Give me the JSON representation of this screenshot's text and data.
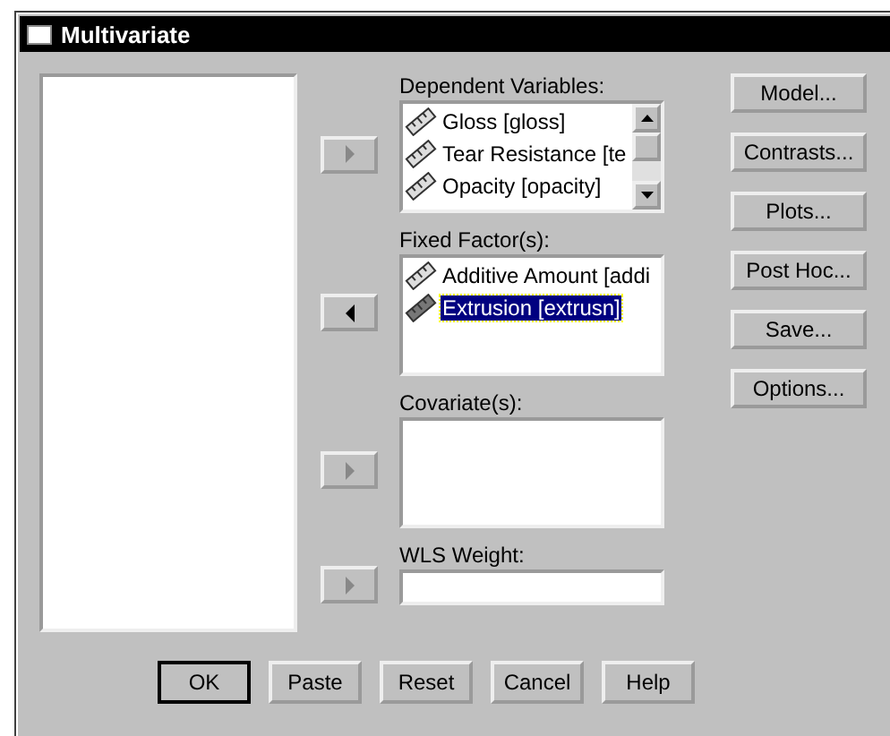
{
  "window": {
    "title": "Multivariate"
  },
  "sections": [
    {
      "label": "Dependent Variables:",
      "kind": "list",
      "arrow": {
        "kind": "right",
        "disabled": true
      },
      "scrollbar": true,
      "items": [
        {
          "text": "Gloss [gloss]",
          "selected": false
        },
        {
          "text": "Tear Resistance [te",
          "selected": false
        },
        {
          "text": "Opacity [opacity]",
          "selected": false
        }
      ]
    },
    {
      "label": "Fixed Factor(s):",
      "kind": "list",
      "arrow": {
        "kind": "left",
        "disabled": false
      },
      "scrollbar": false,
      "items": [
        {
          "text": "Additive Amount [addi",
          "selected": false
        },
        {
          "text": "Extrusion [extrusn]",
          "selected": true
        }
      ]
    },
    {
      "label": "Covariate(s):",
      "kind": "list",
      "arrow": {
        "kind": "right",
        "disabled": true
      },
      "scrollbar": false
    },
    {
      "label": "WLS Weight:",
      "kind": "field",
      "arrow": {
        "kind": "right",
        "disabled": true
      }
    }
  ],
  "side_buttons": [
    "Model...",
    "Contrasts...",
    "Plots...",
    "Post Hoc...",
    "Save...",
    "Options..."
  ],
  "buttons": [
    "OK",
    "Paste",
    "Reset",
    "Cancel",
    "Help"
  ]
}
